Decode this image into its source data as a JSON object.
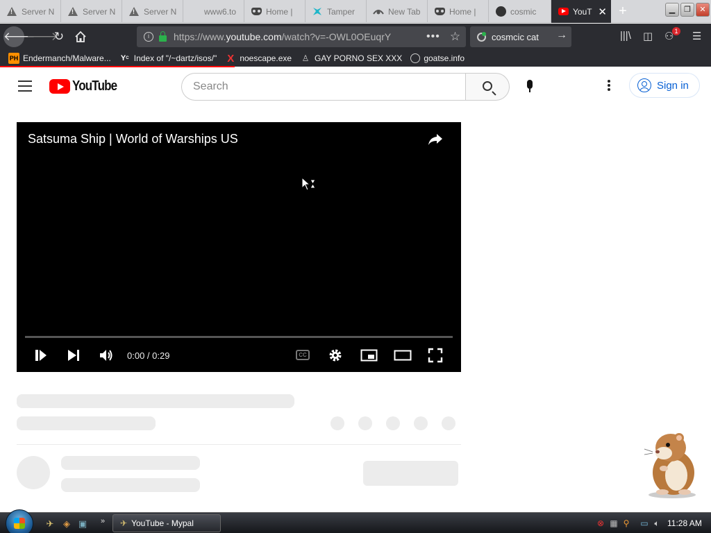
{
  "browser": {
    "tabs": [
      {
        "label": "Server N",
        "icon": "warning-icon"
      },
      {
        "label": "Server N",
        "icon": "warning-icon"
      },
      {
        "label": "Server N",
        "icon": "warning-icon"
      },
      {
        "label": "www6.to",
        "icon": ""
      },
      {
        "label": "Home |",
        "icon": "mask-icon"
      },
      {
        "label": "Tamper",
        "icon": "tampermonkey-icon"
      },
      {
        "label": "New Tab",
        "icon": "new-tab-icon"
      },
      {
        "label": "Home |",
        "icon": "mask-icon"
      },
      {
        "label": "cosmic",
        "icon": "github-icon"
      },
      {
        "label": "YouT",
        "icon": "youtube-icon"
      }
    ],
    "new_tab": "+",
    "url_prefix": "https://www.",
    "url_domain": "youtube.com",
    "url_path": "/watch?v=-OWL0OEuqrY",
    "search_value": "cosmcic cat",
    "extension_badge": "1"
  },
  "bookmarks": [
    {
      "label": "Endermanch/Malware...",
      "icon": "PH"
    },
    {
      "label": "Index of \"/~dartz/isos/\"",
      "icon": "Y"
    },
    {
      "label": "noescape.exe",
      "icon": "X"
    },
    {
      "label": "GAY PORNO SEX XXX",
      "icon": "wizard-icon"
    },
    {
      "label": "goatse.info",
      "icon": "globe-icon"
    }
  ],
  "youtube": {
    "logo_text": "YouTube",
    "search_placeholder": "Search",
    "sign_in": "Sign in"
  },
  "player": {
    "title": "Satsuma Ship | World of Warships US",
    "time": "0:00 / 0:29",
    "cc_label": "CC"
  },
  "taskbar": {
    "task_label": "YouTube - Mypal",
    "clock": "11:28 AM"
  }
}
